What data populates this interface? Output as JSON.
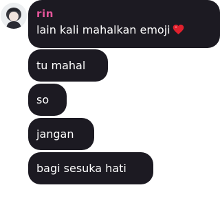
{
  "chat": {
    "sender": {
      "name": "rin",
      "name_color": "#e3559a",
      "avatar_icon": "profile-avatar"
    },
    "bubble_color": "#1c1a22",
    "messages": [
      {
        "text": "lain kali mahalkan emoji",
        "emoji": "red-heart"
      },
      {
        "text": "tu mahal"
      },
      {
        "text": "so"
      },
      {
        "text": "jangan"
      },
      {
        "text": "bagi sesuka hati"
      }
    ]
  }
}
